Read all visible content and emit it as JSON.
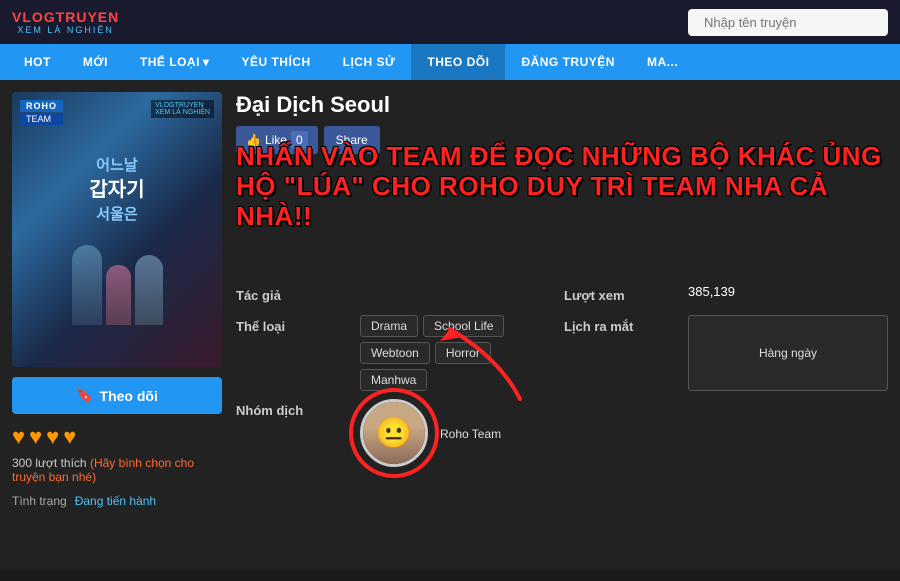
{
  "site": {
    "logo_top": "VLOGTRUYEN",
    "logo_sub": "XEM LÀ NGHIỆN",
    "search_placeholder": "Nhập tên truyện"
  },
  "nav": {
    "items": [
      {
        "label": "HOT",
        "id": "hot"
      },
      {
        "label": "MỚI",
        "id": "moi"
      },
      {
        "label": "THỂ LOẠI",
        "id": "the-loai",
        "has_dropdown": true
      },
      {
        "label": "YÊU THÍCH",
        "id": "yeu-thich"
      },
      {
        "label": "LỊCH SỬ",
        "id": "lich-su"
      },
      {
        "label": "THEO DÕI",
        "id": "theo-doi"
      },
      {
        "label": "ĐĂNG TRUYỆN",
        "id": "dang-truyen"
      },
      {
        "label": "MA...",
        "id": "ma"
      }
    ]
  },
  "manga": {
    "title": "Đại Dịch Seoul",
    "cover_title_kr": "어느날 갑자기 서울은",
    "cover_team": "ROHO",
    "cover_team2": "TEAM",
    "like_count": "0",
    "like_label": "Like",
    "share_label": "Share",
    "announcement": "NHẤN VÀO TEAM ĐỂ ĐỌC NHỮNG BỘ KHÁC ỦNG HỘ \"LÚA\" CHO ROHO DUY TRÌ TEAM NHA CẢ NHÀ!!",
    "author_label": "Tác giả",
    "author_value": "",
    "genre_label": "Thể loại",
    "tags": [
      "Drama",
      "School Life",
      "Webtoon",
      "Horror",
      "Manhwa"
    ],
    "translator_label": "Nhóm dịch",
    "translator_name": "Roho Team",
    "views_label": "Lượt xem",
    "views_value": "385,139",
    "schedule_label": "Lịch ra mắt",
    "schedule_value": "Hàng ngày",
    "follow_btn": "Theo dõi",
    "hearts": [
      "♥",
      "♥",
      "♥",
      "♥"
    ],
    "likes_count": "300 lượt thích",
    "likes_cta": "(Hãy bình chọn cho truyện bạn nhé)",
    "status_label": "Tình trạng",
    "status_value": "Đang tiến hành"
  }
}
